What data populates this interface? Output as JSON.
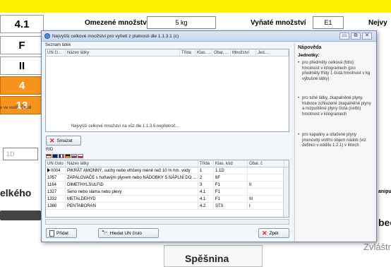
{
  "background": {
    "left_values": [
      "4.1",
      "F",
      "II",
      "4",
      "13"
    ],
    "colons": [
      ":",
      ":",
      ":",
      ":",
      ":"
    ],
    "limited_qty_label": "Omezené množství:",
    "limited_qty_value": "5 kg",
    "excepted_qty_label": "Vyňaté množství",
    "excepted_qty_value": "E1",
    "right_cut_label": "Nejvy",
    "note_text": "e ve vodě. Škodl",
    "partial_value": "1D",
    "big_left_text": "elkého",
    "right_label_a": "anipu",
    "right_label_b": "bec",
    "right_label_c": "Zvláštr",
    "bottom_center": "Spěšnina"
  },
  "dialog": {
    "title": "Nejvyšší celkové množství pro vyňetí z platnosti dle 1.1.3.1 (c)",
    "list_group_label": "Seznam látek",
    "top_grid": {
      "headers": [
        "UN čí...",
        "Název látky",
        "Třída",
        "Klas. ...",
        "Obal. ...",
        "Množství",
        "Jed...."
      ],
      "footer_note": "Nejvyšší celkové množství na vůz dle 1.1.3.6 nepřekroč..."
    },
    "delete_button": "Smazat",
    "rid_label": "RID",
    "bottom_grid": {
      "headers": [
        "UN číslo",
        "Název látky",
        "Třída",
        "Klas. kód",
        "Obal. č"
      ],
      "rows": [
        {
          "un": "0004",
          "name": "PIKRÁT AMONNÝ, suchý nebo vlhčený méně než 10 % hm. vody",
          "cls": "1",
          "code": "1.1D",
          "pack": ""
        },
        {
          "un": "1057",
          "name": "ZAPALOVAČE s hořlavým plynem nebo NÁDOBKY S NÁPLNÍ DO ...",
          "cls": "2",
          "code": "6F",
          "pack": ""
        },
        {
          "un": "1164",
          "name": "DIMETHYLSULFID",
          "cls": "3",
          "code": "F1",
          "pack": "II"
        },
        {
          "un": "1327",
          "name": "Seno nebo sláma nebo plevy",
          "cls": "4.1",
          "code": "F1",
          "pack": ""
        },
        {
          "un": "1332",
          "name": "METALDEHYD",
          "cls": "4.1",
          "code": "F1",
          "pack": "III"
        },
        {
          "un": "1380",
          "name": "PENTABORAN",
          "cls": "4.2",
          "code": "ST3",
          "pack": "I"
        }
      ]
    },
    "add_button": "Přidat",
    "search_un_button": "Hledat UN číslo",
    "back_button": "Zpět",
    "help": {
      "title": "Nápověda",
      "subtitle": "Jednotky:",
      "items": [
        "pro předměty celková (btto) hmotnost v kilogramech (pro předměty třídy 1 čistá hmotnost v kg výbušné látky)",
        "pro tuhé látky, zkapalněné plyny, hluboce zchlazené zkapalněné plyny a rozpuštěné plyny čistá (netto) hmotnost v kilogramech",
        "pro kapaliny a stlačené plyny jmenovitý vnitřní objem nádob (viz definici v oddílu 1.2.1) v litrech"
      ]
    }
  },
  "colors": {
    "top_bar": "#fff100",
    "orange": "#f7941d",
    "dialog_bg": "#eef3fa",
    "delete_icon": "#d32222"
  }
}
